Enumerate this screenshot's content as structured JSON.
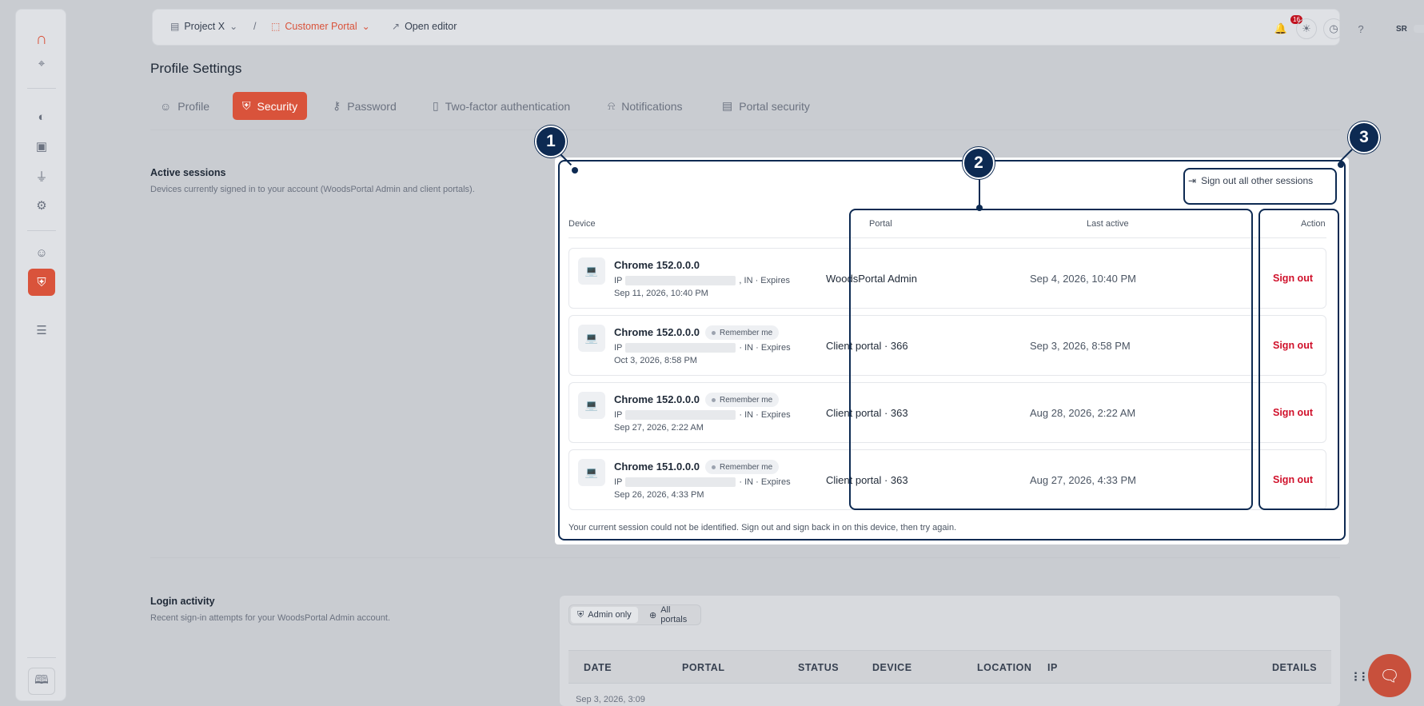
{
  "topbar": {
    "project": "Project X",
    "separator": "/",
    "portal": "Customer Portal",
    "open_editor": "Open editor",
    "notification_count": "16",
    "user_initials": "SR"
  },
  "page": {
    "title": "Profile Settings"
  },
  "tabs": [
    {
      "label": "Profile"
    },
    {
      "label": "Security"
    },
    {
      "label": "Password"
    },
    {
      "label": "Two-factor authentication"
    },
    {
      "label": "Notifications"
    },
    {
      "label": "Portal security"
    }
  ],
  "active_sessions": {
    "title": "Active sessions",
    "description": "Devices currently signed in to your account (WoodsPortal Admin and client portals).",
    "sign_out_all": "Sign out all other sessions",
    "headers": {
      "device": "Device",
      "portal": "Portal",
      "last_active": "Last active",
      "action": "Action"
    },
    "rows": [
      {
        "device": "Chrome 152.0.0.0",
        "remember": "",
        "ip_prefix": "IP",
        "ip_suffix": ", IN · Expires",
        "expires": "Sep 11, 2026, 10:40 PM",
        "portal": "WoodsPortal Admin",
        "last_active": "Sep 4, 2026, 10:40 PM",
        "action": "Sign out"
      },
      {
        "device": "Chrome 152.0.0.0",
        "remember": "Remember me",
        "ip_prefix": "IP",
        "ip_suffix": "· IN · Expires",
        "expires": "Oct 3, 2026, 8:58 PM",
        "portal": "Client portal · 366",
        "last_active": "Sep 3, 2026, 8:58 PM",
        "action": "Sign out"
      },
      {
        "device": "Chrome 152.0.0.0",
        "remember": "Remember me",
        "ip_prefix": "IP",
        "ip_suffix": "· IN · Expires",
        "expires": "Sep 27, 2026, 2:22 AM",
        "portal": "Client portal · 363",
        "last_active": "Aug 28, 2026, 2:22 AM",
        "action": "Sign out"
      },
      {
        "device": "Chrome 151.0.0.0",
        "remember": "Remember me",
        "ip_prefix": "IP",
        "ip_suffix": "· IN · Expires",
        "expires": "Sep 26, 2026, 4:33 PM",
        "portal": "Client portal · 363",
        "last_active": "Aug 27, 2026, 4:33 PM",
        "action": "Sign out"
      }
    ],
    "note": "Your current session could not be identified. Sign out and sign back in on this device, then try again."
  },
  "callouts": [
    "1",
    "2",
    "3"
  ],
  "login_activity": {
    "title": "Login activity",
    "description": "Recent sign-in attempts for your WoodsPortal Admin account.",
    "filter_admin": "Admin only",
    "filter_all": "All portals",
    "headers": [
      "DATE",
      "PORTAL",
      "STATUS",
      "DEVICE",
      "LOCATION",
      "IP",
      "DETAILS"
    ],
    "first_row_date": "Sep 3, 2026, 3:09"
  },
  "colors": {
    "accent": "#d9533b",
    "callout": "#0d2a52",
    "danger": "#d0112b"
  }
}
